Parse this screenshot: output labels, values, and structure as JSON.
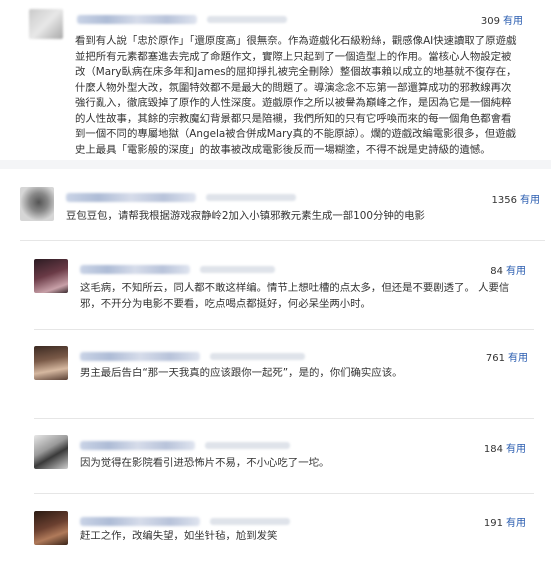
{
  "posts": [
    {
      "votes": "309",
      "vote_label": "有用",
      "text": "看到有人說「忠於原作」「還原度高」很無奈。作為遊戲化石級粉絲，觀感像AI快速讀取了原遊戲並把所有元素都塞進去完成了命題作文，實際上只起到了一個造型上的作用。當核心人物設定被改（Mary臥病在床多年和James的屈抑掙扎被完全刪除）整個故事賴以成立的地基就不復存在，什麼人物外型大改，氛圍特效都不是最大的問題了。導演念念不忘第一部還算成功的邪教線再次強行亂入，徹底毀掉了原作的人性深度。遊戲原作之所以被譽為巔峰之作，是因為它是一個純粹的人性故事，其餘的宗教魔幻背景都只是陪襯，我們所知的只有它呼喚而來的每一個角色都會看到一個不同的專屬地獄（Angela被合併成Mary真的不能原諒）。爛的遊戲改編電影很多，但遊戲史上最具「電影般的深度」的故事被改成電影後反而一場糊塗，不得不說是史詩級的遺憾。"
    },
    {
      "votes": "1356",
      "vote_label": "有用",
      "text": "豆包豆包，请帮我根据游戏寂静岭2加入小镇邪教元素生成一部100分钟的电影"
    }
  ],
  "replies": [
    {
      "votes": "84",
      "vote_label": "有用",
      "text": "这毛病，不知所云，同人都不敢这样编。情节上想吐槽的点太多，但还是不要剧透了。 人要信邪，不开分为电影不要看，吃点喝点都挺好，何必呆坐两小时。"
    },
    {
      "votes": "761",
      "vote_label": "有用",
      "text": "男主最后告白“那一天我真的应该跟你一起死”，是的，你们确实应该。"
    },
    {
      "votes": "184",
      "vote_label": "有用",
      "text": "因为觉得在影院看引进恐怖片不易，不小心吃了一坨。"
    },
    {
      "votes": "191",
      "vote_label": "有用",
      "text": "赶工之作，改编失望，如坐针毡，尬到发笑"
    }
  ]
}
